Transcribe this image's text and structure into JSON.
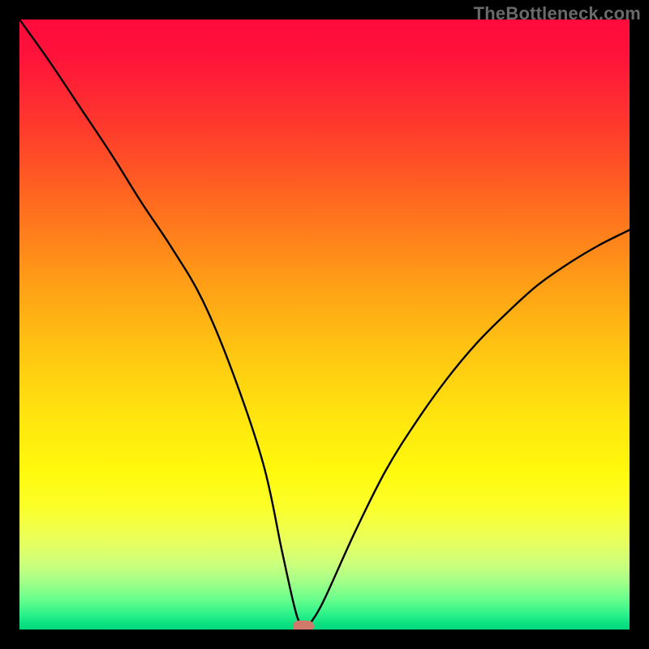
{
  "watermark": "TheBottleneck.com",
  "chart_data": {
    "type": "line",
    "title": "",
    "xlabel": "",
    "ylabel": "",
    "xlim": [
      0,
      100
    ],
    "ylim": [
      0,
      100
    ],
    "grid": false,
    "legend": false,
    "series": [
      {
        "name": "bottleneck-curve",
        "x": [
          0,
          5,
          10,
          15,
          20,
          25,
          30,
          35,
          40,
          43,
          45,
          46,
          47,
          48,
          50,
          55,
          60,
          65,
          70,
          75,
          80,
          85,
          90,
          95,
          100
        ],
        "y": [
          100,
          93,
          85.5,
          78,
          70,
          62.5,
          54,
          42,
          27,
          13,
          4,
          1,
          0.5,
          1.5,
          5,
          16,
          26,
          34,
          41,
          47,
          52,
          56.5,
          60,
          63,
          65.5
        ]
      }
    ],
    "marker": {
      "x": 46.5,
      "y": 0.5
    },
    "background_gradient": {
      "top": "#ff0a3c",
      "mid": "#ffe70e",
      "bottom": "#06d87d"
    }
  }
}
